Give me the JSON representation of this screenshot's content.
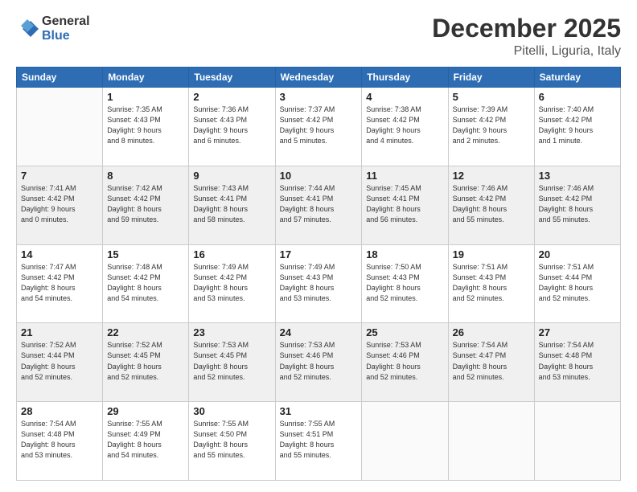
{
  "logo": {
    "general": "General",
    "blue": "Blue"
  },
  "header": {
    "month": "December 2025",
    "location": "Pitelli, Liguria, Italy"
  },
  "weekdays": [
    "Sunday",
    "Monday",
    "Tuesday",
    "Wednesday",
    "Thursday",
    "Friday",
    "Saturday"
  ],
  "weeks": [
    [
      {
        "day": "",
        "info": ""
      },
      {
        "day": "1",
        "info": "Sunrise: 7:35 AM\nSunset: 4:43 PM\nDaylight: 9 hours\nand 8 minutes."
      },
      {
        "day": "2",
        "info": "Sunrise: 7:36 AM\nSunset: 4:43 PM\nDaylight: 9 hours\nand 6 minutes."
      },
      {
        "day": "3",
        "info": "Sunrise: 7:37 AM\nSunset: 4:42 PM\nDaylight: 9 hours\nand 5 minutes."
      },
      {
        "day": "4",
        "info": "Sunrise: 7:38 AM\nSunset: 4:42 PM\nDaylight: 9 hours\nand 4 minutes."
      },
      {
        "day": "5",
        "info": "Sunrise: 7:39 AM\nSunset: 4:42 PM\nDaylight: 9 hours\nand 2 minutes."
      },
      {
        "day": "6",
        "info": "Sunrise: 7:40 AM\nSunset: 4:42 PM\nDaylight: 9 hours\nand 1 minute."
      }
    ],
    [
      {
        "day": "7",
        "info": "Sunrise: 7:41 AM\nSunset: 4:42 PM\nDaylight: 9 hours\nand 0 minutes."
      },
      {
        "day": "8",
        "info": "Sunrise: 7:42 AM\nSunset: 4:42 PM\nDaylight: 8 hours\nand 59 minutes."
      },
      {
        "day": "9",
        "info": "Sunrise: 7:43 AM\nSunset: 4:41 PM\nDaylight: 8 hours\nand 58 minutes."
      },
      {
        "day": "10",
        "info": "Sunrise: 7:44 AM\nSunset: 4:41 PM\nDaylight: 8 hours\nand 57 minutes."
      },
      {
        "day": "11",
        "info": "Sunrise: 7:45 AM\nSunset: 4:41 PM\nDaylight: 8 hours\nand 56 minutes."
      },
      {
        "day": "12",
        "info": "Sunrise: 7:46 AM\nSunset: 4:42 PM\nDaylight: 8 hours\nand 55 minutes."
      },
      {
        "day": "13",
        "info": "Sunrise: 7:46 AM\nSunset: 4:42 PM\nDaylight: 8 hours\nand 55 minutes."
      }
    ],
    [
      {
        "day": "14",
        "info": "Sunrise: 7:47 AM\nSunset: 4:42 PM\nDaylight: 8 hours\nand 54 minutes."
      },
      {
        "day": "15",
        "info": "Sunrise: 7:48 AM\nSunset: 4:42 PM\nDaylight: 8 hours\nand 54 minutes."
      },
      {
        "day": "16",
        "info": "Sunrise: 7:49 AM\nSunset: 4:42 PM\nDaylight: 8 hours\nand 53 minutes."
      },
      {
        "day": "17",
        "info": "Sunrise: 7:49 AM\nSunset: 4:43 PM\nDaylight: 8 hours\nand 53 minutes."
      },
      {
        "day": "18",
        "info": "Sunrise: 7:50 AM\nSunset: 4:43 PM\nDaylight: 8 hours\nand 52 minutes."
      },
      {
        "day": "19",
        "info": "Sunrise: 7:51 AM\nSunset: 4:43 PM\nDaylight: 8 hours\nand 52 minutes."
      },
      {
        "day": "20",
        "info": "Sunrise: 7:51 AM\nSunset: 4:44 PM\nDaylight: 8 hours\nand 52 minutes."
      }
    ],
    [
      {
        "day": "21",
        "info": "Sunrise: 7:52 AM\nSunset: 4:44 PM\nDaylight: 8 hours\nand 52 minutes."
      },
      {
        "day": "22",
        "info": "Sunrise: 7:52 AM\nSunset: 4:45 PM\nDaylight: 8 hours\nand 52 minutes."
      },
      {
        "day": "23",
        "info": "Sunrise: 7:53 AM\nSunset: 4:45 PM\nDaylight: 8 hours\nand 52 minutes."
      },
      {
        "day": "24",
        "info": "Sunrise: 7:53 AM\nSunset: 4:46 PM\nDaylight: 8 hours\nand 52 minutes."
      },
      {
        "day": "25",
        "info": "Sunrise: 7:53 AM\nSunset: 4:46 PM\nDaylight: 8 hours\nand 52 minutes."
      },
      {
        "day": "26",
        "info": "Sunrise: 7:54 AM\nSunset: 4:47 PM\nDaylight: 8 hours\nand 52 minutes."
      },
      {
        "day": "27",
        "info": "Sunrise: 7:54 AM\nSunset: 4:48 PM\nDaylight: 8 hours\nand 53 minutes."
      }
    ],
    [
      {
        "day": "28",
        "info": "Sunrise: 7:54 AM\nSunset: 4:48 PM\nDaylight: 8 hours\nand 53 minutes."
      },
      {
        "day": "29",
        "info": "Sunrise: 7:55 AM\nSunset: 4:49 PM\nDaylight: 8 hours\nand 54 minutes."
      },
      {
        "day": "30",
        "info": "Sunrise: 7:55 AM\nSunset: 4:50 PM\nDaylight: 8 hours\nand 55 minutes."
      },
      {
        "day": "31",
        "info": "Sunrise: 7:55 AM\nSunset: 4:51 PM\nDaylight: 8 hours\nand 55 minutes."
      },
      {
        "day": "",
        "info": ""
      },
      {
        "day": "",
        "info": ""
      },
      {
        "day": "",
        "info": ""
      }
    ]
  ]
}
